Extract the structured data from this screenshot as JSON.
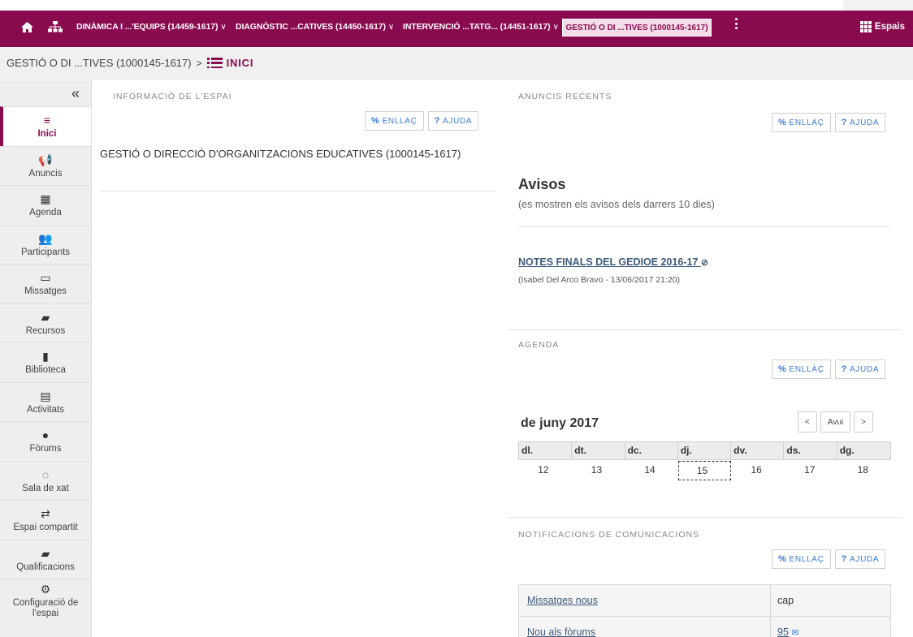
{
  "topbar": {
    "home_icon": "home-icon",
    "tree_icon": "sitemap-icon",
    "tabs": [
      {
        "label": "DINÀMICA I ...'EQUIPS (14459-1617)"
      },
      {
        "label": "DIAGNÒSTIC ...CATIVES (14450-1617)"
      },
      {
        "label": "INTERVENCIÓ ...TATG... (14451-1617)"
      }
    ],
    "active_tab": "GESTIÓ O DI ...TIVES (1000145-1617)",
    "more_icon": "vertical-dots-icon",
    "espais_label": "Espais",
    "colors": {
      "brand": "#8a0a4f",
      "active_tab_bg": "#f4dde8"
    }
  },
  "breadcrumb": {
    "space": "GESTIÓ O DI ...TIVES (1000145-1617)",
    "separator": ">",
    "current": "INICI"
  },
  "sidebar": {
    "collapse_label": "«",
    "items": [
      {
        "label": "Inici",
        "icon": "≡"
      },
      {
        "label": "Anuncis",
        "icon": "📢"
      },
      {
        "label": "Agenda",
        "icon": "▦"
      },
      {
        "label": "Participants",
        "icon": "👥"
      },
      {
        "label": "Missatges",
        "icon": "▭"
      },
      {
        "label": "Recursos",
        "icon": "▰"
      },
      {
        "label": "Biblioteca",
        "icon": "▮"
      },
      {
        "label": "Activitats",
        "icon": "▤"
      },
      {
        "label": "Fòrums",
        "icon": "●"
      },
      {
        "label": "Sala de xat",
        "icon": "◌"
      },
      {
        "label": "Espai compartit",
        "icon": "⇄"
      },
      {
        "label": "Qualificacions",
        "icon": "▰"
      },
      {
        "label": "Configuració de l'espai",
        "icon": "⚙"
      }
    ]
  },
  "buttons": {
    "link_label": "ENLLAÇ",
    "help_label": "AJUDA",
    "help_glyph": "?"
  },
  "info_panel": {
    "title": "INFORMACIÓ DE L'ESPAI",
    "space_name": "GESTIÓ O DIRECCIÓ D'ORGANITZACIONS EDUCATIVES (1000145-1617)"
  },
  "announcements": {
    "title": "ANUNCIS RECENTS",
    "heading": "Avisos",
    "subtitle": "(es mostren els avisos dels darrers 10 dies)",
    "items": [
      {
        "title": "NOTES FINALS DEL GEDIOE 2016-17",
        "meta": "(Isabel Del Arco Bravo - 13/06/2017 21:20)",
        "attach_icon": "paperclip-icon"
      }
    ]
  },
  "agenda": {
    "title": "AGENDA",
    "month": "de juny 2017",
    "prev": "<",
    "today": "Avui",
    "next": ">",
    "weekdays": [
      "dl.",
      "dt.",
      "dc.",
      "dj.",
      "dv.",
      "ds.",
      "dg."
    ],
    "days": [
      "12",
      "13",
      "14",
      "15",
      "16",
      "17",
      "18"
    ],
    "today_day": "15"
  },
  "notifications": {
    "title": "NOTIFICACIONS DE COMUNICACIONS",
    "rows": [
      {
        "label": "Missatges nous",
        "value": "cap"
      },
      {
        "label": "Nou als fòrums",
        "value": "95"
      }
    ]
  }
}
